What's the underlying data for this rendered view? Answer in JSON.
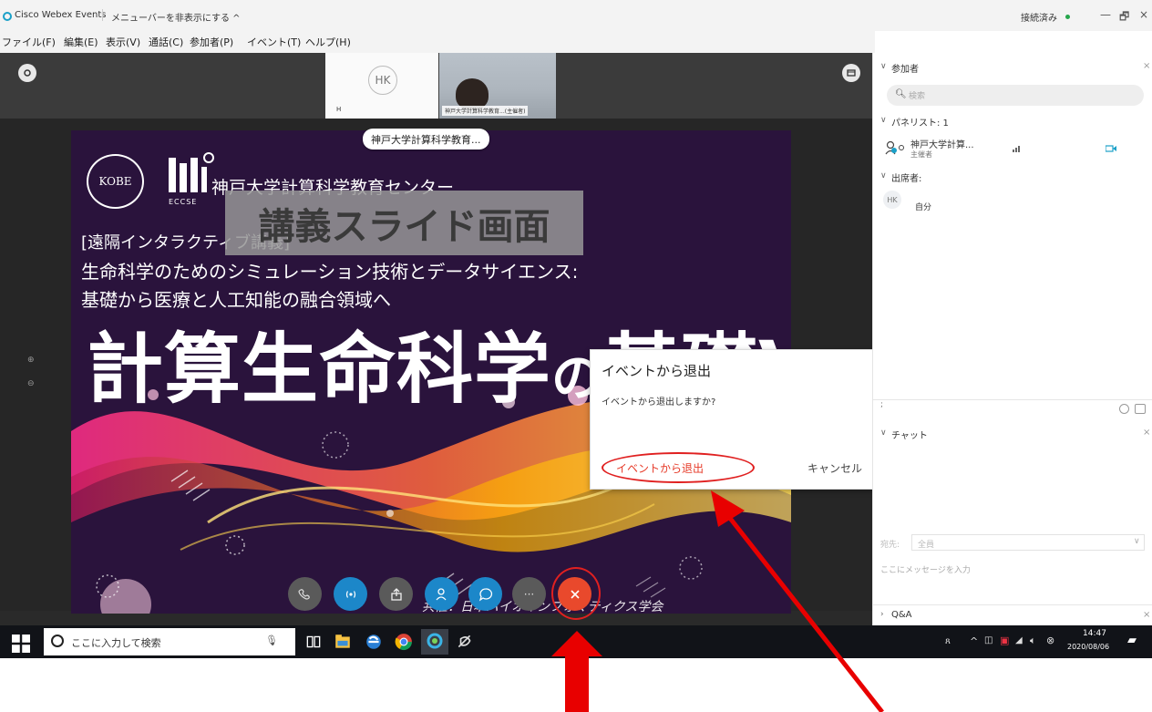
{
  "titlebar": {
    "app_name": "Cisco Webex Events",
    "hide_menu": "メニューバーを非表示にする ^",
    "status": "接続済み",
    "minimize": "—",
    "restore": "🗗",
    "close": "×"
  },
  "menubar": {
    "items": [
      "ファイル(F)",
      "編集(E)",
      "表示(V)",
      "通話(C)",
      "参加者(P)",
      "イベント(T)",
      "ヘルプ(H)"
    ]
  },
  "stage": {
    "hk_initials": "HK",
    "hk_name": "H",
    "video_label": "神戸大学計算科学教育...(主催者)",
    "presenter_tag": "神戸大学計算科学教育...",
    "zoom_in": "⊕",
    "zoom_out": "⊖"
  },
  "slide": {
    "kobe_logo": "KOBE",
    "eccse_logo": "ECCSE",
    "center_name": "神戸大学計算科学教育センター",
    "line1": "[遠隔インタラクティブ講義]",
    "line2": "生命科学のためのシミュレーション技術とデータサイエンス:",
    "line3": "基礎から医療と人工知能の融合領域へ",
    "big_title_a": "計算生命科学",
    "big_title_b": "の",
    "big_title_c": "基礎VII",
    "footer": "共催：日本バイオインフォマティクス学会"
  },
  "overlay_label": "講義スライド画面",
  "dialog": {
    "title": "イベントから退出",
    "message": "イベントから退出しますか?",
    "ghost_text": "術とデータサイエンス:",
    "exit_label": "イベントから退出",
    "cancel_label": "キャンセル"
  },
  "controls": {
    "more_label": "···"
  },
  "panel": {
    "participants_header": "参加者",
    "search_placeholder": "検索",
    "panelists_header": "パネリスト: 1",
    "host_name": "神戸大学計算...",
    "host_role": "主催者",
    "attendees_header": "出席者:",
    "attendee_initials": "HK",
    "attendee_name": "自分",
    "chat_header": "チャット",
    "chat_to_label": "宛先:",
    "chat_to_value": "全員",
    "chat_placeholder": "ここにメッセージを入力",
    "qa_header": "Q&A",
    "close": "×"
  },
  "taskbar": {
    "search_placeholder": "ここに入力して検索",
    "time": "14:47",
    "date": "2020/08/06"
  },
  "colors": {
    "accent_red": "#e02020",
    "leave_red": "#e9492c",
    "webex_blue": "#1c87c9",
    "slide_bg": "#2a133c",
    "status_green": "#26a64b"
  },
  "icons": [
    "webex-logo-icon",
    "settings-icon",
    "layout-icon",
    "phone-icon",
    "audio-icon",
    "share-icon",
    "participants-icon",
    "chat-icon",
    "more-icon",
    "leave-icon",
    "search-icon",
    "windows-icon",
    "cortana-icon"
  ]
}
